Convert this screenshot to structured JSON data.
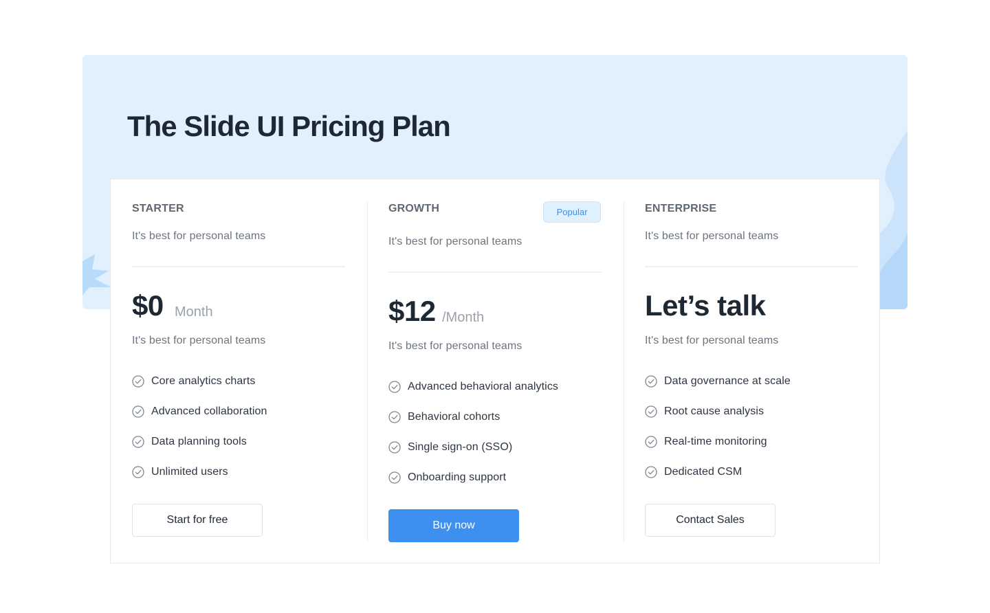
{
  "page": {
    "title": "The Slide UI Pricing Plan"
  },
  "colors": {
    "hero_bg": "#e1f0fd",
    "primary": "#3d8ff0",
    "badge_bg": "#e0f0fd",
    "badge_text": "#3b8fe8",
    "heading": "#1e2833",
    "muted": "#6b7480"
  },
  "plans": [
    {
      "name": "STARTER",
      "tagline": "It's best for personal teams",
      "price": "$0",
      "period": "Month",
      "price_note": "It's best for personal teams",
      "features": [
        "Core analytics charts",
        "Advanced collaboration",
        "Data planning tools",
        "Unlimited users"
      ],
      "feature_icon": "check-circle-icon",
      "cta": "Start for free"
    },
    {
      "name": "GROWTH",
      "badge": "Popular",
      "tagline": "It's best for personal teams",
      "price": "$12",
      "period": "/Month",
      "price_note": "It's best for personal teams",
      "features": [
        "Advanced behavioral analytics",
        "Behavioral cohorts",
        "Single sign-on (SSO)",
        "Onboarding support"
      ],
      "feature_icon": "check-circle-icon",
      "cta": "Buy now"
    },
    {
      "name": "ENTERPRISE",
      "tagline": "It's best for personal teams",
      "price": "Let’s talk",
      "price_note": "It's best for personal teams",
      "features": [
        "Data governance at scale",
        "Root cause analysis",
        "Real-time monitoring",
        "Dedicated CSM"
      ],
      "feature_icon": "check-circle-icon",
      "cta": "Contact Sales"
    }
  ]
}
